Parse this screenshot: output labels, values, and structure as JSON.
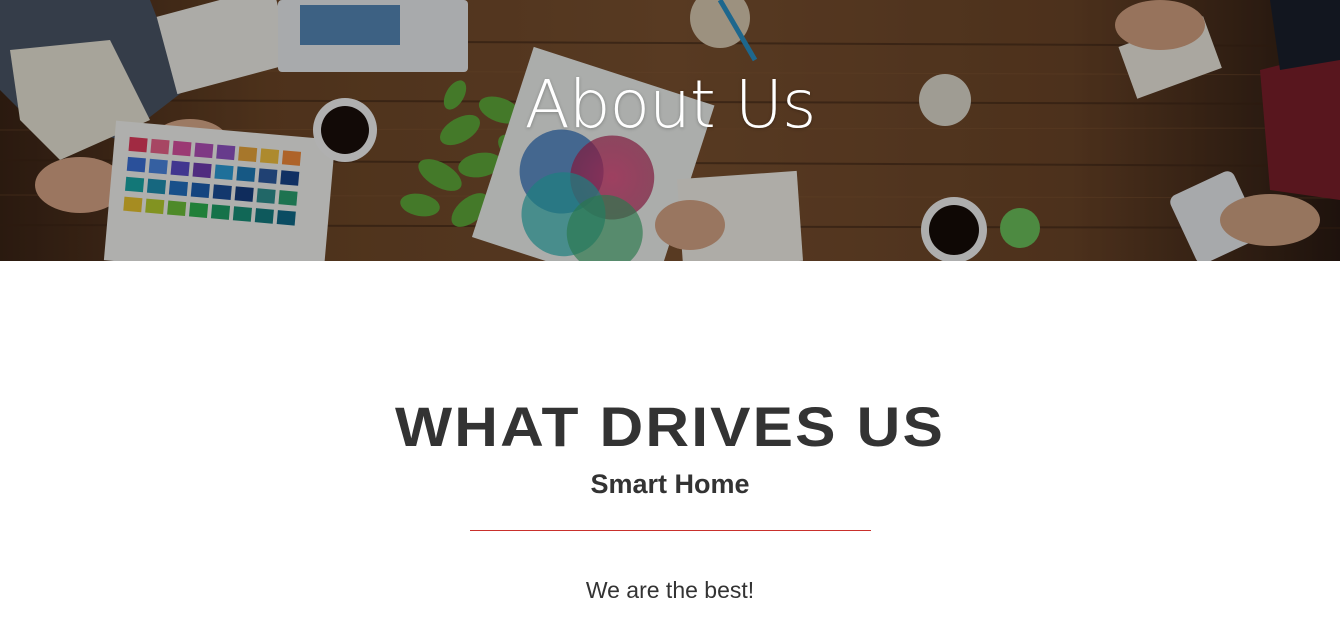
{
  "hero": {
    "title": "About Us"
  },
  "section": {
    "title": "WHAT DRIVES US",
    "subtitle": "Smart Home",
    "divider_color": "#c9302c",
    "tagline": "We are the best!"
  }
}
